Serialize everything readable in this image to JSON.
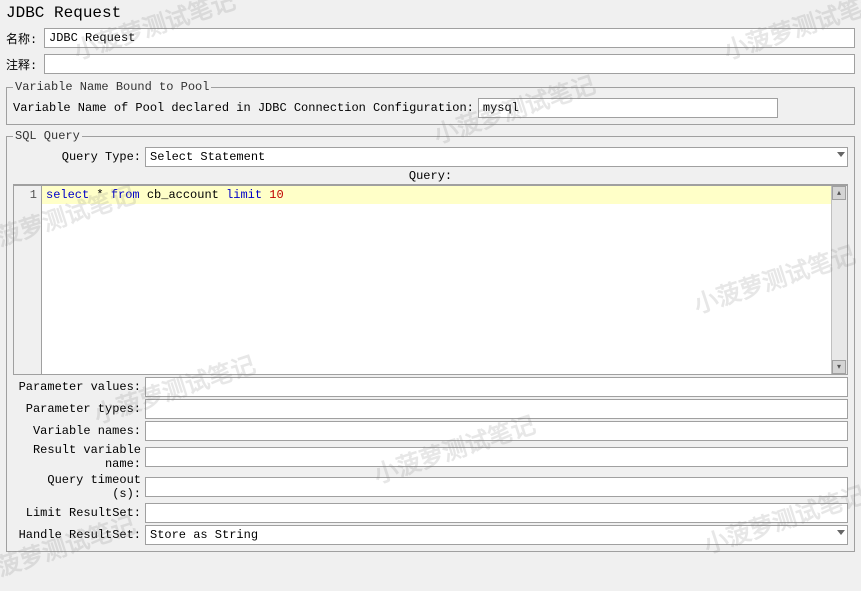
{
  "title": "JDBC Request",
  "labels": {
    "name": "名称:",
    "comments": "注释:"
  },
  "name_value": "JDBC Request",
  "comments_value": "",
  "pool": {
    "legend": "Variable Name Bound to Pool",
    "label": "Variable Name of Pool declared in JDBC Connection Configuration:",
    "value": "mysql"
  },
  "sql": {
    "legend": "SQL Query",
    "query_type_label": "Query Type:",
    "query_type_value": "Select Statement",
    "query_header": "Query:",
    "line_number": "1",
    "query_tokens": [
      {
        "t": "select ",
        "c": "kw"
      },
      {
        "t": "* ",
        "c": ""
      },
      {
        "t": "from ",
        "c": "kw"
      },
      {
        "t": "cb_account ",
        "c": ""
      },
      {
        "t": "limit ",
        "c": "kw"
      },
      {
        "t": "10",
        "c": "num"
      }
    ],
    "params": {
      "parameter_values": {
        "label": "Parameter values:",
        "value": ""
      },
      "parameter_types": {
        "label": "Parameter types:",
        "value": ""
      },
      "variable_names": {
        "label": "Variable names:",
        "value": ""
      },
      "result_variable_name": {
        "label": "Result variable name:",
        "value": ""
      },
      "query_timeout": {
        "label": "Query timeout (s):",
        "value": ""
      },
      "limit_resultset": {
        "label": "Limit ResultSet:",
        "value": ""
      },
      "handle_resultset": {
        "label": "Handle ResultSet:",
        "value": "Store as String"
      }
    }
  },
  "watermark_text": "小菠萝测试笔记"
}
